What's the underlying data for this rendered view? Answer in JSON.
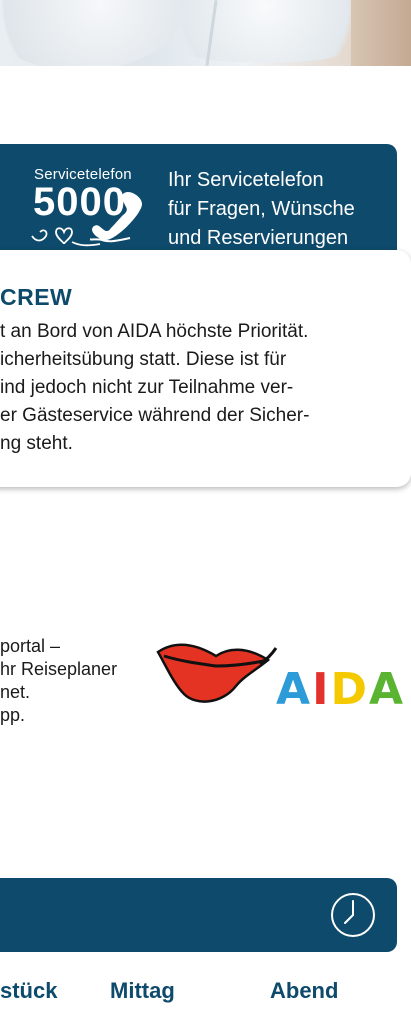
{
  "service": {
    "small_label": "Servicetelefon",
    "number": "5000",
    "lines": [
      "Ihr Servicetelefon",
      "für Fragen, Wünsche",
      "und Reservierungen"
    ]
  },
  "crew": {
    "title": "CREW",
    "lines": [
      "t an Bord von AIDA höchste Priorität.",
      "icherheitsübung statt. Diese ist für",
      "ind jedoch nicht zur Teilnahme ver-",
      "er Gästeservice während der Sicher-",
      "ng steht."
    ]
  },
  "portal": {
    "lines": [
      "portal –",
      "hr Reiseplaner",
      "net.",
      "pp."
    ]
  },
  "logo": {
    "letters": [
      "A",
      "I",
      "D",
      "A"
    ],
    "letter_colors": [
      "#2d9bd8",
      "#e3312d",
      "#f5c900",
      "#5bb431"
    ]
  },
  "tabs": [
    "stück",
    "Mittag",
    "Abend"
  ],
  "colors": {
    "brand_dark": "#0e4a6b",
    "lips_red": "#e53323"
  }
}
